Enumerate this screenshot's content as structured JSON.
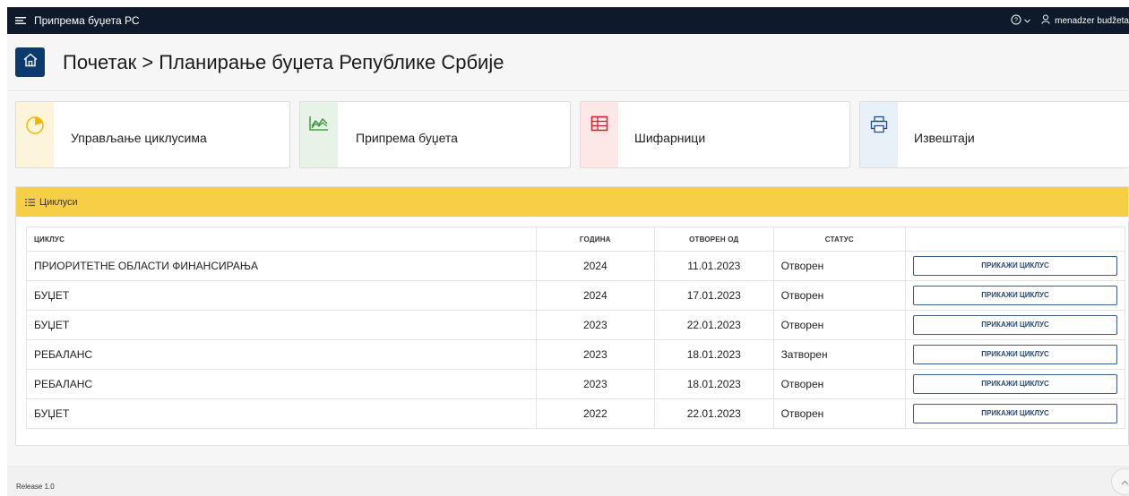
{
  "topbar": {
    "menu_icon": "hamburger-menu-icon",
    "app_title": "Припрема буџета РС",
    "help_icon": "help-circle-icon",
    "user_icon": "user-icon",
    "user_name": "menadzer budžeta"
  },
  "header": {
    "home_icon": "home-icon",
    "breadcrumb": "Почетак > Планирање буџета Републике Србије"
  },
  "cards": [
    {
      "label": "Управљање циклусима",
      "icon": "pie-chart-icon",
      "accent": "#fdf4dc",
      "icon_color": "#f2b705"
    },
    {
      "label": "Припрема буџета",
      "icon": "area-chart-icon",
      "accent": "#e6f3e6",
      "icon_color": "#2e8b2e"
    },
    {
      "label": "Шифарници",
      "icon": "table-grid-icon",
      "accent": "#fde7e7",
      "icon_color": "#d61f2b"
    },
    {
      "label": "Извештаји",
      "icon": "printer-icon",
      "accent": "#e8f0f8",
      "icon_color": "#1a4f8a"
    }
  ],
  "cycles_panel": {
    "title": "Циклуси",
    "icon": "list-icon",
    "accent": "#f7cf47",
    "columns": [
      "ЦИКЛУС",
      "ГОДИНА",
      "ОТВОРЕН ОД",
      "СТАТУС",
      ""
    ],
    "rows": [
      {
        "cycle": "ПРИОРИТЕТНЕ ОБЛАСТИ ФИНАНСИРАЊА",
        "year": "2024",
        "opened": "11.01.2023",
        "status": "Отворен",
        "action": "ПРИКАЖИ ЦИКЛУС"
      },
      {
        "cycle": "БУЏЕТ",
        "year": "2024",
        "opened": "17.01.2023",
        "status": "Отворен",
        "action": "ПРИКАЖИ ЦИКЛУС"
      },
      {
        "cycle": "БУЏЕТ",
        "year": "2023",
        "opened": "22.01.2023",
        "status": "Отворен",
        "action": "ПРИКАЖИ ЦИКЛУС"
      },
      {
        "cycle": "РЕБАЛАНС",
        "year": "2023",
        "opened": "18.01.2023",
        "status": "Затворен",
        "action": "ПРИКАЖИ ЦИКЛУС"
      },
      {
        "cycle": "РЕБАЛАНС",
        "year": "2023",
        "opened": "18.01.2023",
        "status": "Отворен",
        "action": "ПРИКАЖИ ЦИКЛУС"
      },
      {
        "cycle": "БУЏЕТ",
        "year": "2022",
        "opened": "22.01.2023",
        "status": "Отворен",
        "action": "ПРИКАЖИ ЦИКЛУС"
      }
    ]
  },
  "footer": {
    "release": "Release 1.0",
    "scroll_top_icon": "chevron-up-icon"
  }
}
